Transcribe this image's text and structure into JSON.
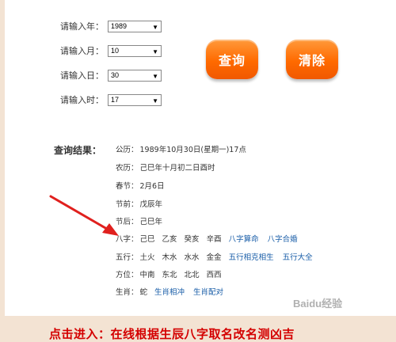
{
  "form": {
    "year_label": "请输入年：",
    "year_value": "1989",
    "month_label": "请输入月：",
    "month_value": "10",
    "day_label": "请输入日：",
    "day_value": "30",
    "hour_label": "请输入时：",
    "hour_value": "17"
  },
  "buttons": {
    "query": "查询",
    "clear": "清除"
  },
  "result": {
    "title": "查询结果：",
    "gongli_label": "公历：",
    "gongli_value": "1989年10月30日(星期一)17点",
    "nongli_label": "农历：",
    "nongli_value": "己巳年十月初二日酉时",
    "chunjie_label": "春节：",
    "chunjie_value": "2月6日",
    "jieqian_label": "节前：",
    "jieqian_value": "戊辰年",
    "jiehou_label": "节后：",
    "jiehou_value": "己巳年",
    "bazi_label": "八字：",
    "bazi_values": [
      "己巳",
      "乙亥",
      "癸亥",
      "辛酉"
    ],
    "bazi_links": [
      "八字算命",
      "八字合婚"
    ],
    "wuxing_label": "五行：",
    "wuxing_values": [
      "土火",
      "木水",
      "水水",
      "金金"
    ],
    "wuxing_links": [
      "五行相克相生",
      "五行大全"
    ],
    "fangwei_label": "方位：",
    "fangwei_values": [
      "中南",
      "东北",
      "北北",
      "西西"
    ],
    "shengxiao_label": "生肖：",
    "shengxiao_value": "蛇",
    "shengxiao_links": [
      "生肖相冲",
      "生肖配对"
    ]
  },
  "banner": {
    "text": "点击进入：在线根据生辰八字取名改名测凶吉"
  },
  "watermark": {
    "text": "Baidu经验"
  },
  "colors": {
    "accent": "#ff6a00",
    "link": "#1a5ea8",
    "banner_text": "#d40000",
    "banner_bg": "#f3e3d3"
  }
}
